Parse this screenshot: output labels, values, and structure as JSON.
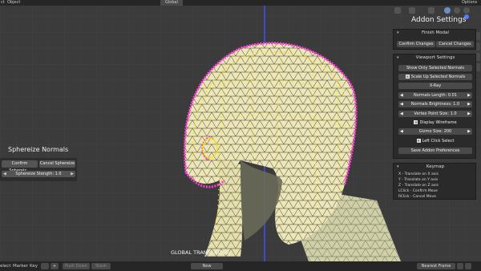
{
  "topbar": {
    "left_label": "ct",
    "object_menu": "Object",
    "global_label": "Global",
    "options_label": "Options"
  },
  "left_panel": {
    "title": "Sphereize Normals",
    "confirm_label": "Confirm Sphereiz...",
    "cancel_label": "Cancel Sphereize",
    "strength_label": "Sphereize Stength: 1.0"
  },
  "addon": {
    "title": "Addon Settings",
    "finish_modal": {
      "header": "Finish Modal",
      "confirm_label": "Confirm Changes",
      "cancel_label": "Cancel Changes"
    },
    "viewport_settings": {
      "header": "Viewport Settings",
      "show_only_selected": "Show Only Selected Normals",
      "scale_up_selected": "Scale Up Selected Normals",
      "xray": "X-Ray",
      "normals_length": "Normals Length: 0.01",
      "normals_brightness": "Normals Brightness: 1.0",
      "vertex_point_size": "Vertex Point Size: 1.0",
      "display_wireframe": "Display Wireframe",
      "gizmo_size": "Gizmo Size: 200",
      "left_click_select": "Left Click Select",
      "save_preferences": "Save Addon Preferences"
    },
    "keymap": {
      "header": "Keymap",
      "lines": [
        "X - Translate on X axis",
        "Y - Translate on Y axis",
        "Z - Translate on Z axis",
        "LClick - Confirm Move",
        "RClick - Cancel Move"
      ]
    }
  },
  "overlay_text": "GLOBAL TRANSLATING",
  "bottombar": {
    "select": "elect",
    "marker": "Marker",
    "key": "Key",
    "push_down": "Push Down",
    "stash": "Stash",
    "new": "New",
    "nearest_frame": "Nearest Frame"
  },
  "colors": {
    "viewport_bg": "#3b3b3b",
    "mesh_fill": "#e8e2b2",
    "normals": "#ff3cd8",
    "selected_verts": "#f5e200",
    "axis_blue": "#3f4fff"
  }
}
